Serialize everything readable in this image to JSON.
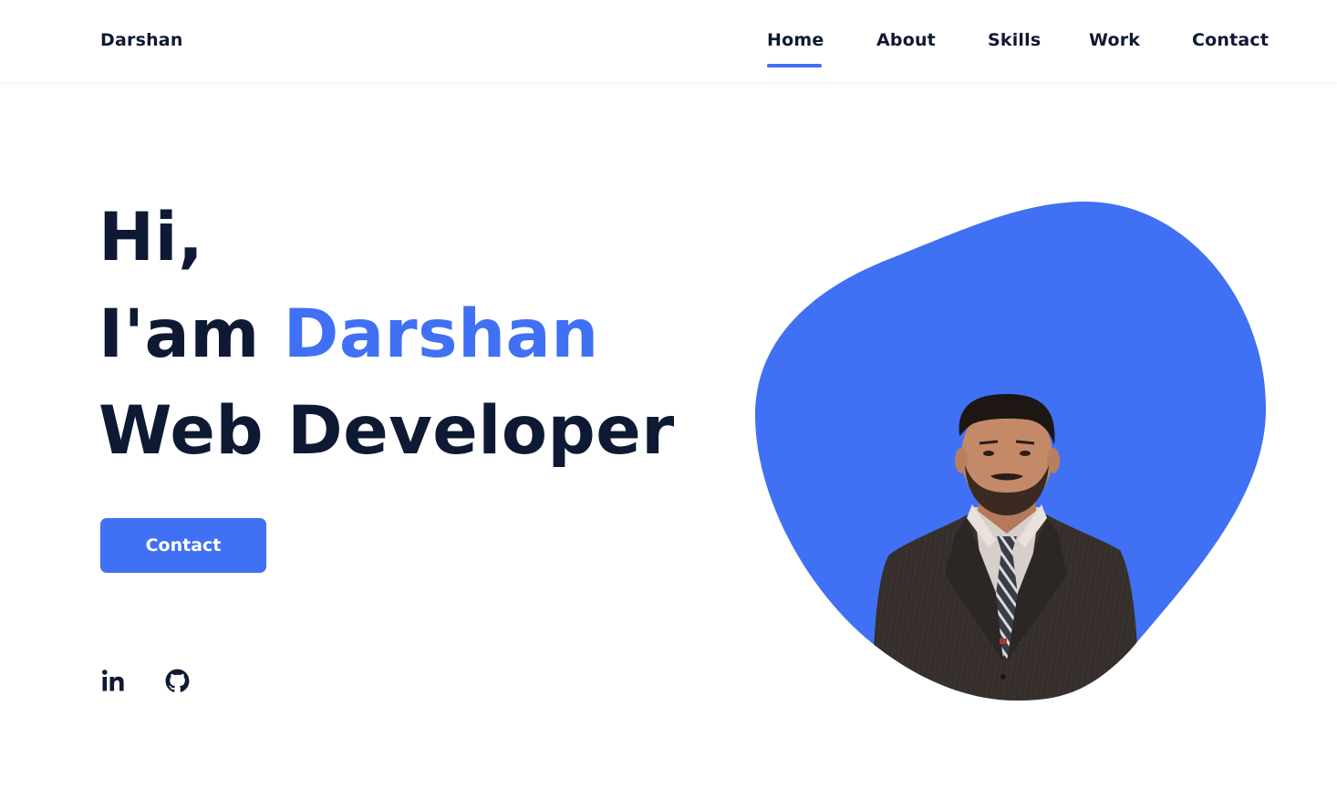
{
  "header": {
    "logo": "Darshan",
    "nav": [
      {
        "label": "Home",
        "active": true
      },
      {
        "label": "About",
        "active": false
      },
      {
        "label": "Skills",
        "active": false
      },
      {
        "label": "Work",
        "active": false
      },
      {
        "label": "Contact",
        "active": false
      }
    ]
  },
  "hero": {
    "greeting": "Hi,",
    "intro": "I'am",
    "name": "Darshan",
    "role": "Web Developer",
    "button_label": "Contact"
  },
  "social": [
    {
      "icon": "linkedin-icon"
    },
    {
      "icon": "github-icon"
    }
  ],
  "colors": {
    "accent": "#4070f4",
    "text": "#0e1a33",
    "background": "#ffffff"
  }
}
